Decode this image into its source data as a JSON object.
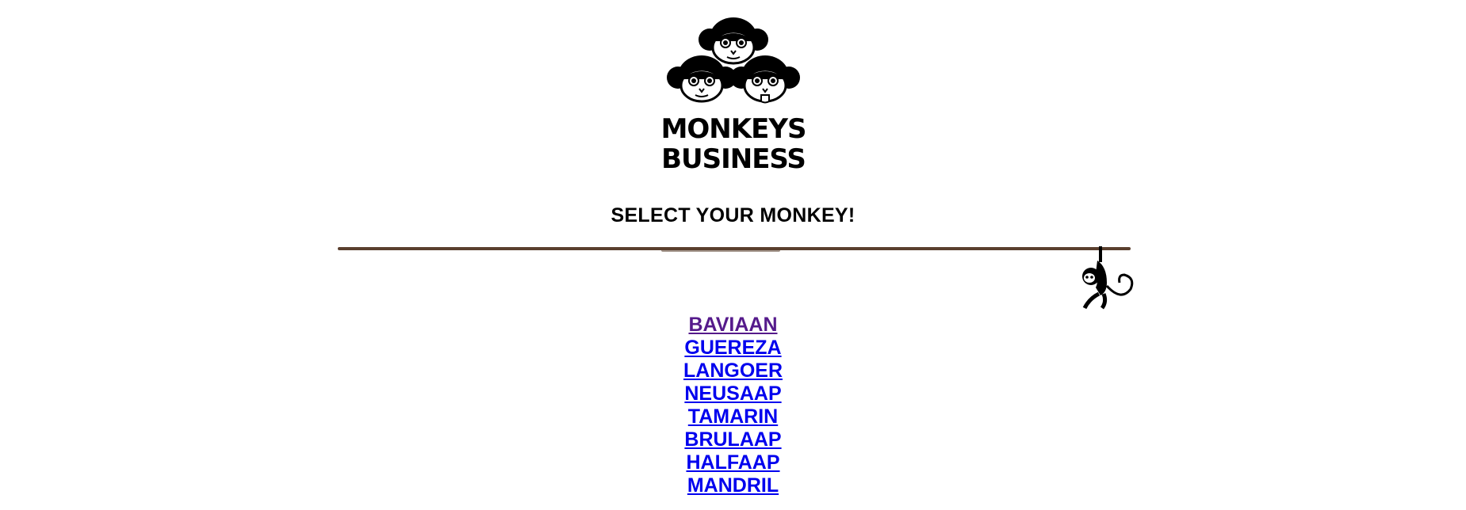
{
  "logo": {
    "text_line1": "MONKEYS",
    "text_line2": "BUSINESS",
    "icon": "three-monkeys-logo"
  },
  "heading": "SELECT YOUR MONKEY!",
  "decoration": {
    "vine_color": "#5a3f2e",
    "hanging_icon": "hanging-monkey-icon"
  },
  "monkeys": [
    {
      "label": "BAVIAAN",
      "visited": true
    },
    {
      "label": "GUEREZA",
      "visited": false
    },
    {
      "label": "LANGOER",
      "visited": false
    },
    {
      "label": "NEUSAAP",
      "visited": false
    },
    {
      "label": "TAMARIN",
      "visited": false
    },
    {
      "label": "BRULAAP",
      "visited": false
    },
    {
      "label": "HALFAAP",
      "visited": false
    },
    {
      "label": "MANDRIL",
      "visited": false
    }
  ],
  "colors": {
    "link": "#0000ee",
    "visited_link": "#551a8b",
    "text": "#000000"
  }
}
